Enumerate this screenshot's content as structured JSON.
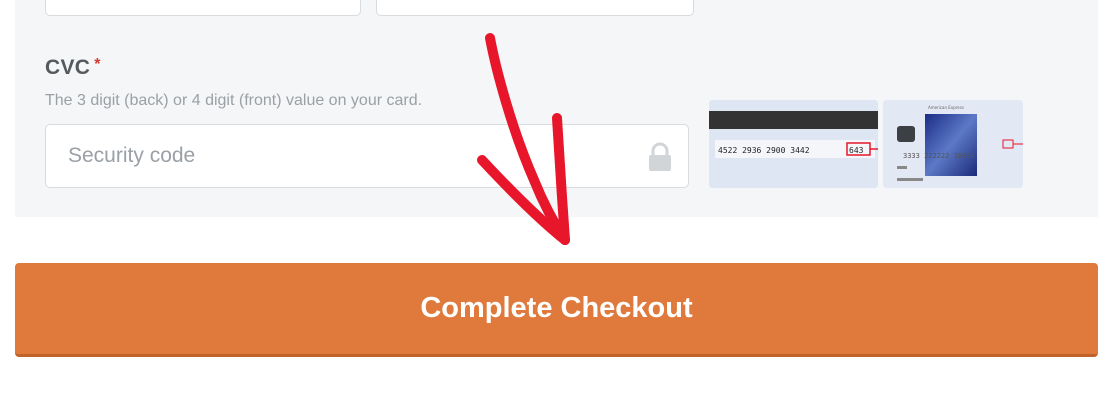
{
  "cvc": {
    "label": "CVC",
    "required_marker": "*",
    "help_text": "The 3 digit (back) or 4 digit (front) value on your card.",
    "input": {
      "placeholder": "Security code",
      "value": ""
    }
  },
  "card_images": {
    "back": {
      "card_number": "4522 2936 2900 3442",
      "cvc": "643"
    },
    "front": {
      "issuer": "American Express",
      "number": "3333 222222 10000"
    }
  },
  "checkout": {
    "button_label": "Complete Checkout"
  },
  "colors": {
    "button": "#e07a3c",
    "panel": "#f5f6f7",
    "required": "#d33a2c",
    "arrow": "#e8162b"
  },
  "icons": {
    "lock": "lock-icon",
    "annotation_arrow": "arrow-down-icon"
  }
}
